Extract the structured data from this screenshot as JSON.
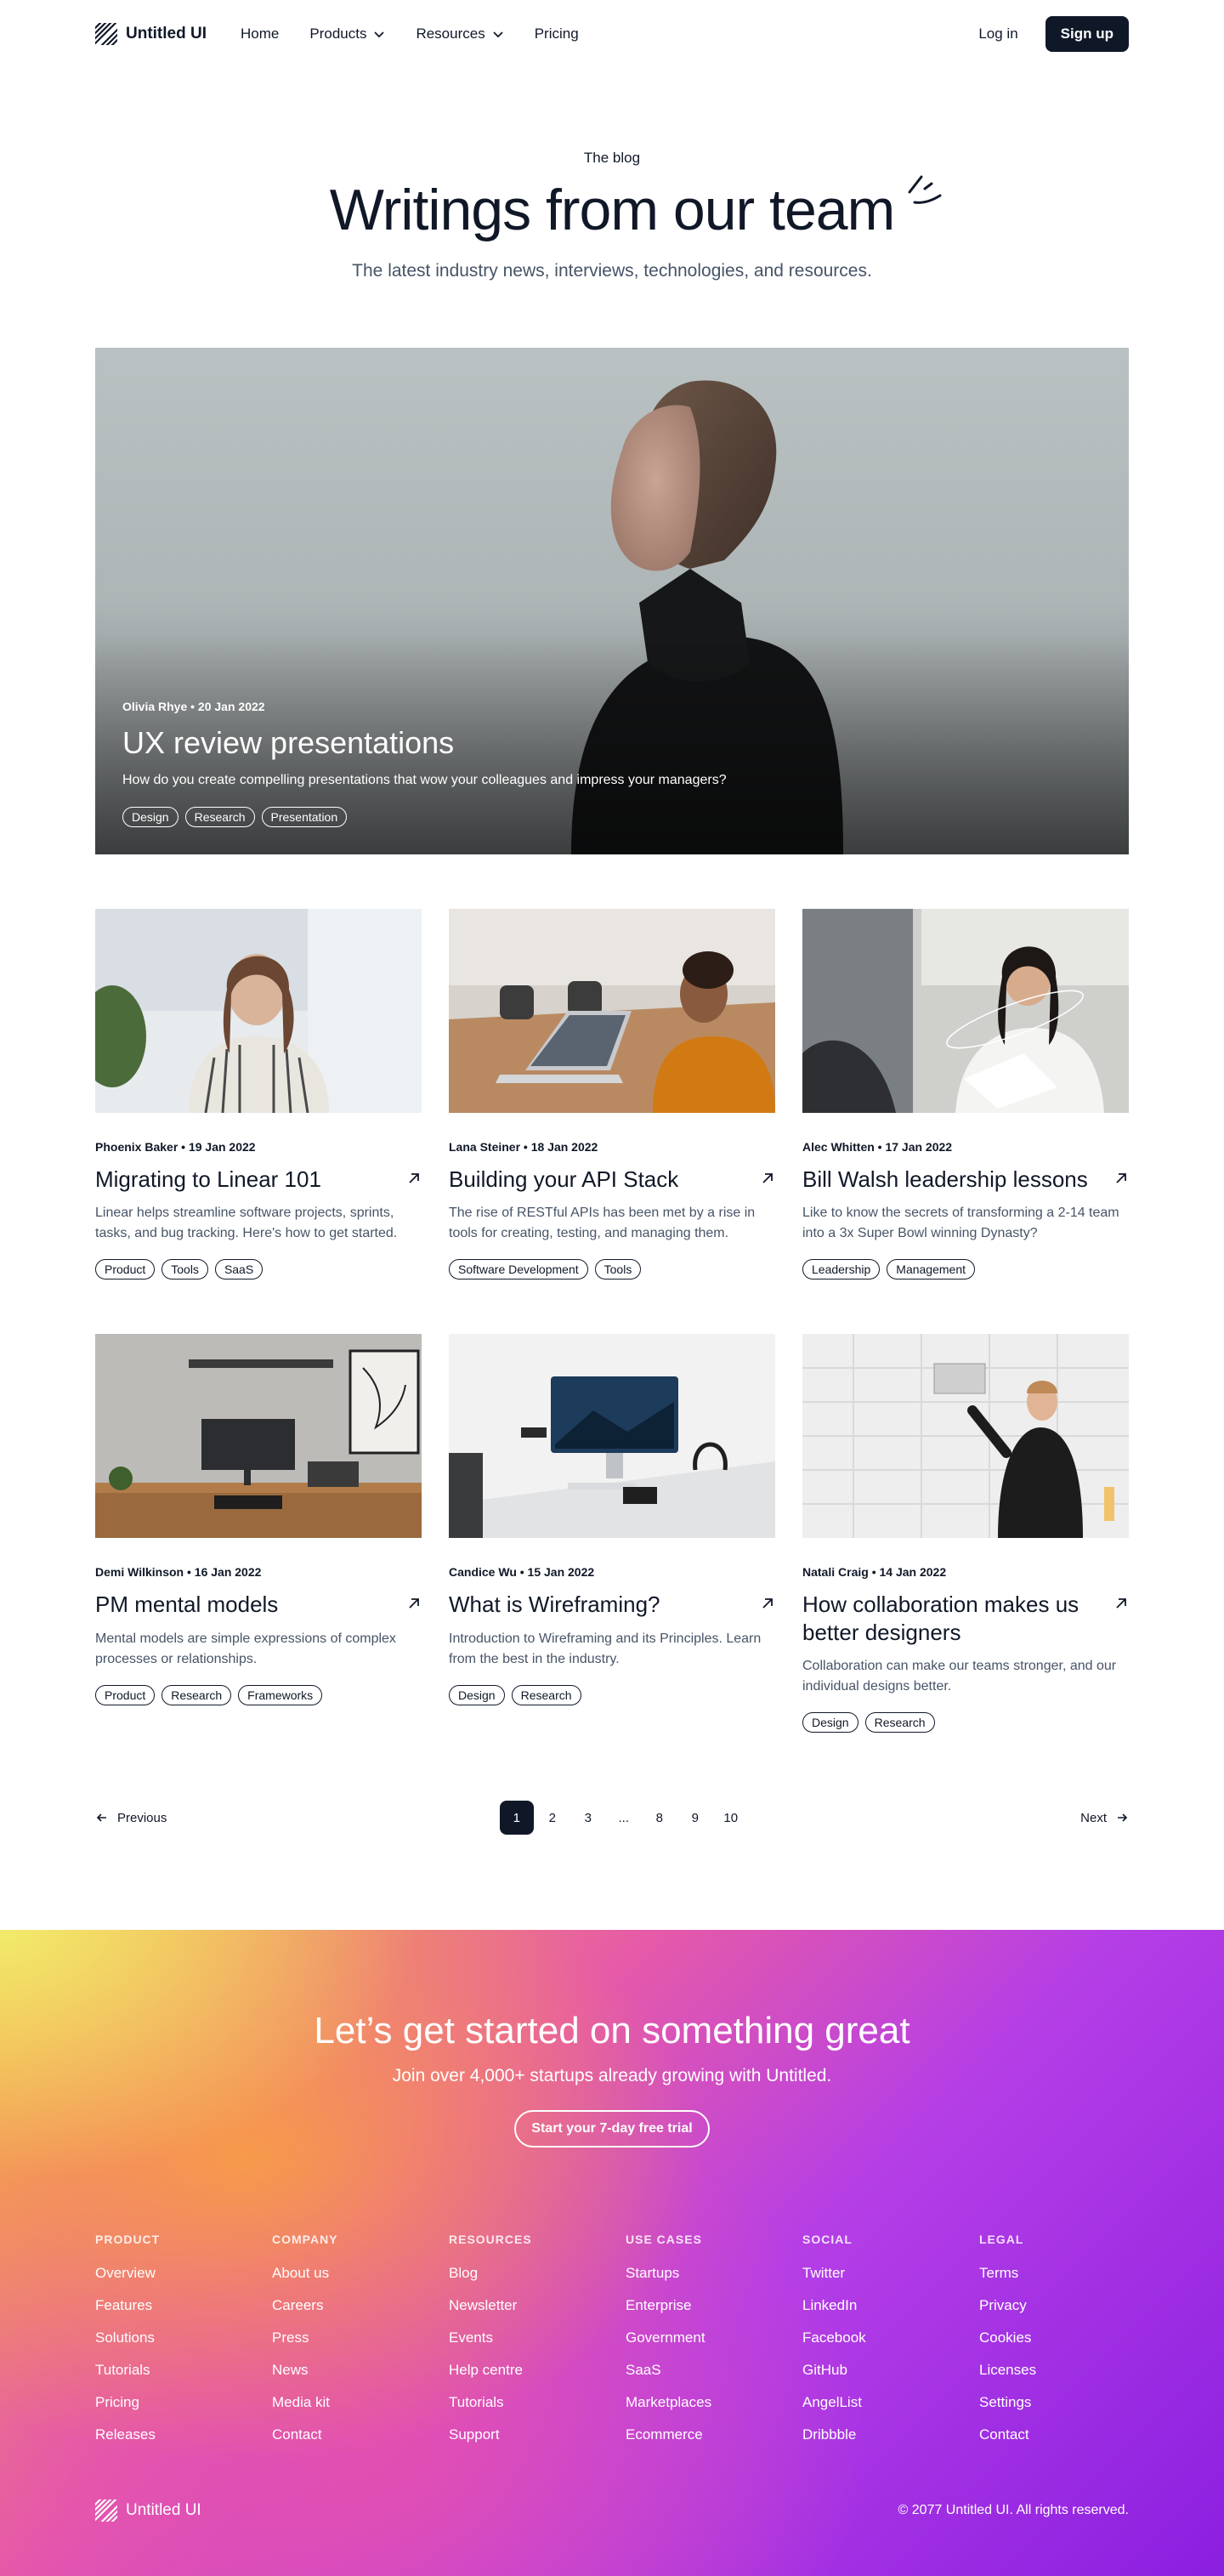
{
  "nav": {
    "logo_text": "Untitled UI",
    "links": [
      {
        "label": "Home"
      },
      {
        "label": "Products"
      },
      {
        "label": "Resources"
      },
      {
        "label": "Pricing"
      }
    ],
    "login": "Log in",
    "signup": "Sign up"
  },
  "hero": {
    "eyebrow": "The blog",
    "title": "Writings from our team",
    "subtitle": "The latest industry news, interviews, technologies, and resources."
  },
  "featured": {
    "meta": "Olivia Rhye • 20 Jan 2022",
    "title": "UX review presentations",
    "description": "How do you create compelling presentations that wow your colleagues and impress your managers?",
    "tags": [
      "Design",
      "Research",
      "Presentation"
    ]
  },
  "posts": [
    {
      "meta": "Phoenix Baker • 19 Jan 2022",
      "title": "Migrating to Linear 101",
      "description": "Linear helps streamline software projects, sprints, tasks, and bug tracking. Here's how to get started.",
      "tags": [
        "Product",
        "Tools",
        "SaaS"
      ]
    },
    {
      "meta": "Lana Steiner • 18 Jan 2022",
      "title": "Building your API Stack",
      "description": "The rise of RESTful APIs has been met by a rise in tools for creating, testing, and managing them.",
      "tags": [
        "Software Development",
        "Tools"
      ]
    },
    {
      "meta": "Alec Whitten • 17 Jan 2022",
      "title": "Bill Walsh leadership lessons",
      "description": "Like to know the secrets of transforming a 2-14 team into a 3x Super Bowl winning Dynasty?",
      "tags": [
        "Leadership",
        "Management"
      ]
    },
    {
      "meta": "Demi Wilkinson • 16 Jan 2022",
      "title": "PM mental models",
      "description": "Mental models are simple expressions of complex processes or relationships.",
      "tags": [
        "Product",
        "Research",
        "Frameworks"
      ]
    },
    {
      "meta": "Candice Wu • 15 Jan 2022",
      "title": "What is Wireframing?",
      "description": "Introduction to Wireframing and its Principles. Learn from the best in the industry.",
      "tags": [
        "Design",
        "Research"
      ]
    },
    {
      "meta": "Natali Craig • 14 Jan 2022",
      "title": "How collaboration makes us better designers",
      "description": "Collaboration can make our teams stronger, and our individual designs better.",
      "tags": [
        "Design",
        "Research"
      ]
    }
  ],
  "pagination": {
    "previous": "Previous",
    "next": "Next",
    "pages": [
      "1",
      "2",
      "3",
      "...",
      "8",
      "9",
      "10"
    ],
    "current": "1"
  },
  "cta": {
    "title": "Let’s get started on something great",
    "subtitle": "Join over 4,000+ startups already growing with Untitled.",
    "button": "Start your 7-day free trial"
  },
  "footer": {
    "columns": [
      {
        "heading": "PRODUCT",
        "links": [
          "Overview",
          "Features",
          "Solutions",
          "Tutorials",
          "Pricing",
          "Releases"
        ]
      },
      {
        "heading": "COMPANY",
        "links": [
          "About us",
          "Careers",
          "Press",
          "News",
          "Media kit",
          "Contact"
        ]
      },
      {
        "heading": "RESOURCES",
        "links": [
          "Blog",
          "Newsletter",
          "Events",
          "Help centre",
          "Tutorials",
          "Support"
        ]
      },
      {
        "heading": "USE CASES",
        "links": [
          "Startups",
          "Enterprise",
          "Government",
          "SaaS",
          "Marketplaces",
          "Ecommerce"
        ]
      },
      {
        "heading": "SOCIAL",
        "links": [
          "Twitter",
          "LinkedIn",
          "Facebook",
          "GitHub",
          "AngelList",
          "Dribbble"
        ]
      },
      {
        "heading": "LEGAL",
        "links": [
          "Terms",
          "Privacy",
          "Cookies",
          "Licenses",
          "Settings",
          "Contact"
        ]
      }
    ],
    "logo_text": "Untitled UI",
    "copyright": "© 2077 Untitled UI. All rights reserved."
  },
  "icons": {
    "logo": "diagonal-stripes-logo-icon",
    "chevron": "chevron-down-icon",
    "arrow": "arrow-up-right-icon",
    "prev": "arrow-left-icon",
    "next": "arrow-right-icon"
  },
  "colors": {
    "text": "#101828",
    "muted": "#475467",
    "active_page": "#101828"
  }
}
